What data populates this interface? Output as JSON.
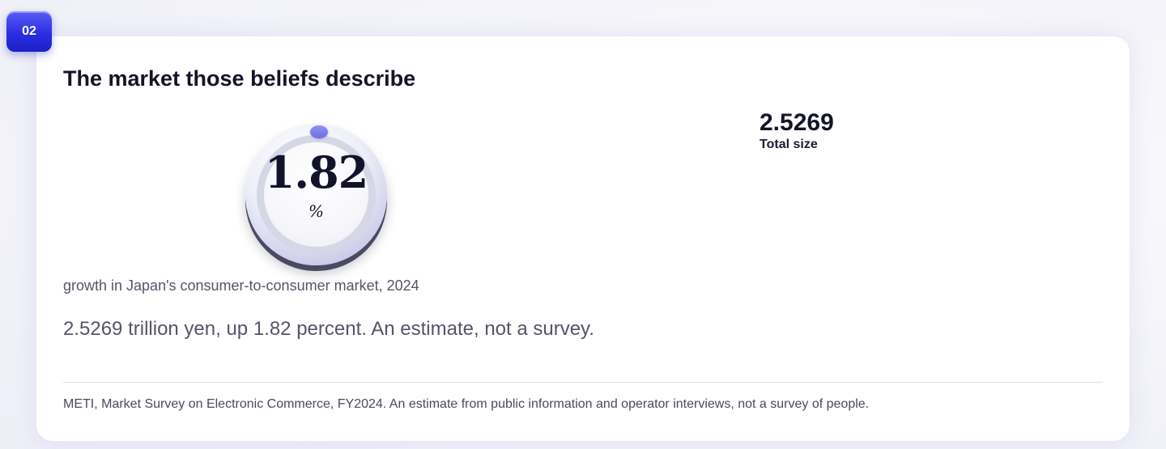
{
  "badge": {
    "label": "02"
  },
  "card": {
    "title": "The market those beliefs describe",
    "dial": {
      "value": "1.82",
      "unit": "%"
    },
    "stat": {
      "value": "2.5269",
      "label": "Total size"
    },
    "caption": "growth in Japan's consumer-to-consumer market, 2024",
    "summary": "2.5269 trillion yen, up 1.82 percent. An estimate, not a survey.",
    "source": "METI, Market Survey on Electronic Commerce, FY2024. An estimate from public information and operator interviews, not a survey of people."
  },
  "colors": {
    "accent": "#2b2ee0",
    "title_text": "#141428",
    "muted_text": "#55556a"
  }
}
